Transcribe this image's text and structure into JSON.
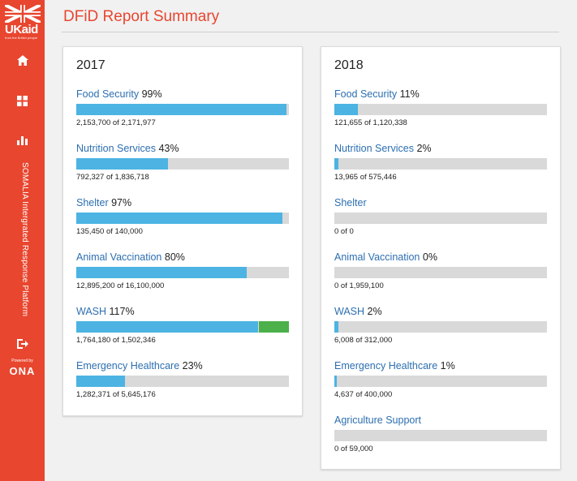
{
  "sidebar": {
    "logo_text": "UKaid",
    "logo_subtext": "from the British people",
    "nav_items": [
      {
        "icon": "home-icon"
      },
      {
        "icon": "grid-icon"
      },
      {
        "icon": "bar-chart-icon"
      },
      {
        "icon": "logout-icon"
      }
    ],
    "project_label": "SOMALIA Intergrated Response Platform",
    "powered_by": "Powered by",
    "brand": "ONA"
  },
  "header": {
    "title": "DFiD Report Summary"
  },
  "colors": {
    "accent": "#e8462f",
    "link": "#2c6fb0",
    "bar_blue": "#4cb3e3",
    "bar_green": "#4cb04b",
    "bar_bg": "#d9d9d9"
  },
  "cards": [
    {
      "year": "2017",
      "items": [
        {
          "name": "Food Security",
          "pct": "99%",
          "sub": "2,153,700 of 2,171,977",
          "ratio": 0.99
        },
        {
          "name": "Nutrition Services",
          "pct": "43%",
          "sub": "792,327 of 1,836,718",
          "ratio": 0.43
        },
        {
          "name": "Shelter",
          "pct": "97%",
          "sub": "135,450 of 140,000",
          "ratio": 0.97
        },
        {
          "name": "Animal Vaccination",
          "pct": "80%",
          "sub": "12,895,200 of 16,100,000",
          "ratio": 0.8
        },
        {
          "name": "WASH",
          "pct": "117%",
          "sub": "1,764,180 of 1,502,346",
          "ratio": 1.17
        },
        {
          "name": "Emergency Healthcare",
          "pct": "23%",
          "sub": "1,282,371 of 5,645,176",
          "ratio": 0.23
        }
      ]
    },
    {
      "year": "2018",
      "items": [
        {
          "name": "Food Security",
          "pct": "11%",
          "sub": "121,655 of 1,120,338",
          "ratio": 0.11
        },
        {
          "name": "Nutrition Services",
          "pct": "2%",
          "sub": "13,965 of 575,446",
          "ratio": 0.02
        },
        {
          "name": "Shelter",
          "pct": "",
          "sub": "0 of 0",
          "ratio": 0
        },
        {
          "name": "Animal Vaccination",
          "pct": "0%",
          "sub": "0 of 1,959,100",
          "ratio": 0
        },
        {
          "name": "WASH",
          "pct": "2%",
          "sub": "6,008 of 312,000",
          "ratio": 0.02
        },
        {
          "name": "Emergency Healthcare",
          "pct": "1%",
          "sub": "4,637 of 400,000",
          "ratio": 0.01
        },
        {
          "name": "Agriculture Support",
          "pct": "",
          "sub": "0 of 59,000",
          "ratio": 0
        }
      ]
    }
  ]
}
